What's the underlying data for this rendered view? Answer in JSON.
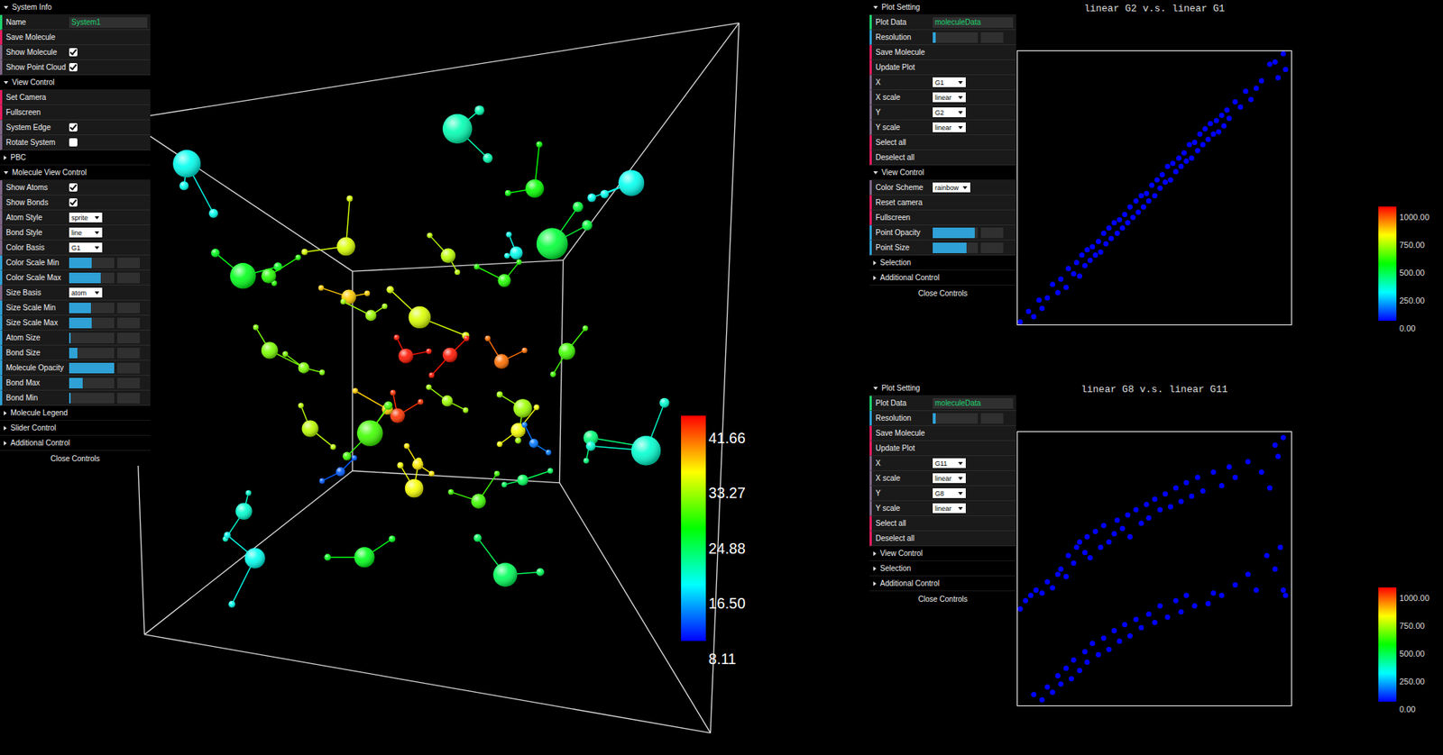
{
  "left_panel": {
    "folders": [
      {
        "title": "System Info",
        "expanded": true,
        "items": [
          {
            "kind": "text",
            "label": "Name",
            "value": "System1"
          },
          {
            "kind": "button",
            "label": "Save Molecule"
          },
          {
            "kind": "checkbox",
            "label": "Show Molecule",
            "checked": true
          },
          {
            "kind": "checkbox",
            "label": "Show Point Cloud",
            "checked": true
          }
        ]
      },
      {
        "title": "View Control",
        "expanded": true,
        "items": [
          {
            "kind": "button",
            "label": "Set Camera"
          },
          {
            "kind": "button",
            "label": "Fullscreen"
          },
          {
            "kind": "checkbox",
            "label": "System Edge",
            "checked": true
          },
          {
            "kind": "checkbox",
            "label": "Rotate System",
            "checked": false
          }
        ]
      },
      {
        "title": "PBC",
        "expanded": false,
        "items": []
      },
      {
        "title": "Molecule View Control",
        "expanded": true,
        "items": [
          {
            "kind": "checkbox",
            "label": "Show Atoms",
            "checked": true
          },
          {
            "kind": "checkbox",
            "label": "Show Bonds",
            "checked": true
          },
          {
            "kind": "select",
            "label": "Atom Style",
            "value": "sprite"
          },
          {
            "kind": "select",
            "label": "Bond Style",
            "value": "line"
          },
          {
            "kind": "select",
            "label": "Color Basis",
            "value": "G1"
          },
          {
            "kind": "slider",
            "label": "Color Scale Min",
            "level": 0.5
          },
          {
            "kind": "slider",
            "label": "Color Scale Max",
            "level": 0.7
          },
          {
            "kind": "select",
            "label": "Size Basis",
            "value": "atom"
          },
          {
            "kind": "slider",
            "label": "Size Scale Min",
            "level": 0.48
          },
          {
            "kind": "slider",
            "label": "Size Scale Max",
            "level": 0.5
          },
          {
            "kind": "slider",
            "label": "Atom Size",
            "level": 0.03
          },
          {
            "kind": "slider",
            "label": "Bond Size",
            "level": 0.18
          },
          {
            "kind": "slider",
            "label": "Molecule Opacity",
            "level": 1.0
          },
          {
            "kind": "slider",
            "label": "Bond Max",
            "level": 0.3
          },
          {
            "kind": "slider",
            "label": "Bond Min",
            "level": 0.04
          }
        ]
      },
      {
        "title": "Molecule Legend",
        "expanded": false,
        "items": []
      },
      {
        "title": "Slider Control",
        "expanded": false,
        "items": []
      },
      {
        "title": "Additional Control",
        "expanded": false,
        "items": []
      }
    ],
    "close": "Close Controls"
  },
  "viewer": {
    "colorbar": {
      "labels": [
        "41.66",
        "33.27",
        "24.88",
        "16.50",
        "8.11"
      ]
    },
    "molecules": [
      {
        "value": 17
      },
      {
        "value": 19
      },
      {
        "value": 25
      },
      {
        "value": 17
      },
      {
        "value": 23
      },
      {
        "value": 24
      },
      {
        "value": 26
      },
      {
        "value": 32
      },
      {
        "value": 35
      },
      {
        "value": 32
      },
      {
        "value": 31
      },
      {
        "value": 26
      },
      {
        "value": 29
      },
      {
        "value": 41
      },
      {
        "value": 41
      },
      {
        "value": 38
      },
      {
        "value": 27
      },
      {
        "value": 40
      },
      {
        "value": 35
      },
      {
        "value": 30
      },
      {
        "value": 33
      },
      {
        "value": 27
      },
      {
        "value": 31
      },
      {
        "value": 33
      },
      {
        "value": 27
      },
      {
        "value": 22
      },
      {
        "value": 21
      },
      {
        "value": 18
      },
      {
        "value": 18
      },
      {
        "value": 17
      },
      {
        "value": 24
      },
      {
        "value": 22
      },
      {
        "value": 17
      },
      {
        "value": 30
      },
      {
        "value": 30
      },
      {
        "value": 12
      },
      {
        "value": 11
      },
      {
        "value": 34
      },
      {
        "value": 29
      }
    ]
  },
  "plots": [
    {
      "title": "linear G2 v.s. linear G1",
      "panel": {
        "folders": [
          {
            "title": "Plot Setting",
            "expanded": true,
            "items": [
              {
                "kind": "text",
                "label": "Plot Data",
                "value": "moleculeData"
              },
              {
                "kind": "slider",
                "label": "Resolution",
                "level": 0.06
              },
              {
                "kind": "button",
                "label": "Save Molecule"
              },
              {
                "kind": "button",
                "label": "Update Plot"
              },
              {
                "kind": "select",
                "label": "X",
                "value": "G1"
              },
              {
                "kind": "select",
                "label": "X scale",
                "value": "linear"
              },
              {
                "kind": "select",
                "label": "Y",
                "value": "G2"
              },
              {
                "kind": "select",
                "label": "Y scale",
                "value": "linear"
              },
              {
                "kind": "button",
                "label": "Select all"
              },
              {
                "kind": "button",
                "label": "Deselect all"
              }
            ]
          },
          {
            "title": "View Control",
            "expanded": true,
            "items": [
              {
                "kind": "select",
                "label": "Color Scheme",
                "value": "rainbow"
              },
              {
                "kind": "button",
                "label": "Reset camera"
              },
              {
                "kind": "button",
                "label": "Fullscreen"
              },
              {
                "kind": "slider",
                "label": "Point Opacity",
                "level": 0.94
              },
              {
                "kind": "slider",
                "label": "Point Size",
                "level": 0.75
              }
            ]
          },
          {
            "title": "Selection",
            "expanded": false,
            "items": []
          },
          {
            "title": "Additional Control",
            "expanded": false,
            "items": []
          }
        ],
        "close": "Close Controls"
      },
      "points": [
        [
          0,
          0
        ],
        [
          3,
          4
        ],
        [
          5,
          2
        ],
        [
          7,
          8
        ],
        [
          8,
          5
        ],
        [
          10,
          9
        ],
        [
          12,
          14
        ],
        [
          14,
          11
        ],
        [
          15,
          16
        ],
        [
          17,
          13
        ],
        [
          18,
          20
        ],
        [
          20,
          18
        ],
        [
          21,
          22
        ],
        [
          22,
          17
        ],
        [
          23,
          25
        ],
        [
          24,
          21
        ],
        [
          25,
          27
        ],
        [
          26,
          23
        ],
        [
          27,
          28
        ],
        [
          28,
          25
        ],
        [
          29,
          30
        ],
        [
          30,
          26
        ],
        [
          31,
          33
        ],
        [
          32,
          29
        ],
        [
          33,
          35
        ],
        [
          34,
          31
        ],
        [
          35,
          37
        ],
        [
          36,
          33
        ],
        [
          37,
          38
        ],
        [
          38,
          35
        ],
        [
          39,
          40
        ],
        [
          40,
          37
        ],
        [
          41,
          43
        ],
        [
          42,
          39
        ],
        [
          43,
          45
        ],
        [
          44,
          41
        ],
        [
          45,
          47
        ],
        [
          46,
          43
        ],
        [
          47,
          48
        ],
        [
          48,
          45
        ],
        [
          49,
          51
        ],
        [
          50,
          47
        ],
        [
          51,
          53
        ],
        [
          52,
          50
        ],
        [
          53,
          55
        ],
        [
          54,
          52
        ],
        [
          55,
          58
        ],
        [
          56,
          53
        ],
        [
          57,
          59
        ],
        [
          58,
          56
        ],
        [
          59,
          61
        ],
        [
          60,
          58
        ],
        [
          61,
          63
        ],
        [
          62,
          60
        ],
        [
          63,
          66
        ],
        [
          64,
          61
        ],
        [
          65,
          67
        ],
        [
          66,
          64
        ],
        [
          67,
          70
        ],
        [
          68,
          66
        ],
        [
          69,
          72
        ],
        [
          70,
          68
        ],
        [
          71,
          74
        ],
        [
          72,
          70
        ],
        [
          73,
          75
        ],
        [
          74,
          71
        ],
        [
          75,
          77
        ],
        [
          76,
          73
        ],
        [
          77,
          79
        ],
        [
          78,
          76
        ],
        [
          80,
          82
        ],
        [
          82,
          80
        ],
        [
          84,
          86
        ],
        [
          86,
          83
        ],
        [
          88,
          87
        ],
        [
          90,
          90
        ],
        [
          93,
          96
        ],
        [
          95,
          97
        ],
        [
          96,
          91
        ],
        [
          98,
          100
        ],
        [
          99,
          94
        ]
      ],
      "colorbar": {
        "labels": [
          "1000.00",
          "750.00",
          "500.00",
          "250.00",
          "0.00"
        ]
      }
    },
    {
      "title": "linear G8 v.s. linear G11",
      "panel": {
        "folders": [
          {
            "title": "Plot Setting",
            "expanded": true,
            "items": [
              {
                "kind": "text",
                "label": "Plot Data",
                "value": "moleculeData"
              },
              {
                "kind": "slider",
                "label": "Resolution",
                "level": 0.06
              },
              {
                "kind": "button",
                "label": "Save Molecule"
              },
              {
                "kind": "button",
                "label": "Update Plot"
              },
              {
                "kind": "select",
                "label": "X",
                "value": "G11"
              },
              {
                "kind": "select",
                "label": "X scale",
                "value": "linear"
              },
              {
                "kind": "select",
                "label": "Y",
                "value": "G8"
              },
              {
                "kind": "select",
                "label": "Y scale",
                "value": "linear"
              },
              {
                "kind": "button",
                "label": "Select all"
              },
              {
                "kind": "button",
                "label": "Deselect all"
              }
            ]
          },
          {
            "title": "View Control",
            "expanded": false,
            "items": []
          },
          {
            "title": "Selection",
            "expanded": false,
            "items": []
          },
          {
            "title": "Additional Control",
            "expanded": false,
            "items": []
          }
        ],
        "close": "Close Controls"
      },
      "points": [
        [
          0,
          35
        ],
        [
          2,
          38
        ],
        [
          4,
          40
        ],
        [
          6,
          42
        ],
        [
          8,
          41
        ],
        [
          10,
          45
        ],
        [
          12,
          43
        ],
        [
          14,
          48
        ],
        [
          15,
          50
        ],
        [
          17,
          47
        ],
        [
          18,
          55
        ],
        [
          20,
          52
        ],
        [
          21,
          58
        ],
        [
          22,
          60
        ],
        [
          24,
          56
        ],
        [
          25,
          62
        ],
        [
          26,
          54
        ],
        [
          28,
          64
        ],
        [
          30,
          58
        ],
        [
          31,
          66
        ],
        [
          33,
          60
        ],
        [
          35,
          63
        ],
        [
          36,
          68
        ],
        [
          38,
          65
        ],
        [
          40,
          70
        ],
        [
          41,
          62
        ],
        [
          43,
          72
        ],
        [
          45,
          67
        ],
        [
          47,
          74
        ],
        [
          48,
          69
        ],
        [
          50,
          76
        ],
        [
          52,
          72
        ],
        [
          54,
          78
        ],
        [
          56,
          73
        ],
        [
          58,
          80
        ],
        [
          60,
          75
        ],
        [
          62,
          82
        ],
        [
          64,
          77
        ],
        [
          66,
          84
        ],
        [
          68,
          79
        ],
        [
          72,
          86
        ],
        [
          75,
          81
        ],
        [
          78,
          88
        ],
        [
          80,
          84
        ],
        [
          85,
          90
        ],
        [
          90,
          86
        ],
        [
          95,
          96
        ],
        [
          98,
          99
        ],
        [
          93,
          80
        ],
        [
          96,
          92
        ],
        [
          5,
          3
        ],
        [
          8,
          1
        ],
        [
          10,
          6
        ],
        [
          12,
          4
        ],
        [
          14,
          10
        ],
        [
          15,
          7
        ],
        [
          17,
          13
        ],
        [
          19,
          9
        ],
        [
          20,
          16
        ],
        [
          22,
          12
        ],
        [
          24,
          19
        ],
        [
          25,
          15
        ],
        [
          27,
          22
        ],
        [
          29,
          18
        ],
        [
          31,
          24
        ],
        [
          33,
          20
        ],
        [
          35,
          27
        ],
        [
          37,
          23
        ],
        [
          39,
          29
        ],
        [
          41,
          25
        ],
        [
          43,
          31
        ],
        [
          45,
          28
        ],
        [
          48,
          33
        ],
        [
          50,
          30
        ],
        [
          52,
          36
        ],
        [
          55,
          32
        ],
        [
          58,
          38
        ],
        [
          60,
          34
        ],
        [
          62,
          40
        ],
        [
          65,
          36
        ],
        [
          70,
          37
        ],
        [
          72,
          41
        ],
        [
          75,
          40
        ],
        [
          80,
          44
        ],
        [
          85,
          48
        ],
        [
          88,
          42
        ],
        [
          95,
          50
        ],
        [
          98,
          42
        ],
        [
          92,
          55
        ],
        [
          97,
          58
        ],
        [
          99,
          40
        ]
      ],
      "colorbar": {
        "labels": [
          "1000.00",
          "750.00",
          "500.00",
          "250.00",
          "0.00"
        ]
      }
    }
  ]
}
